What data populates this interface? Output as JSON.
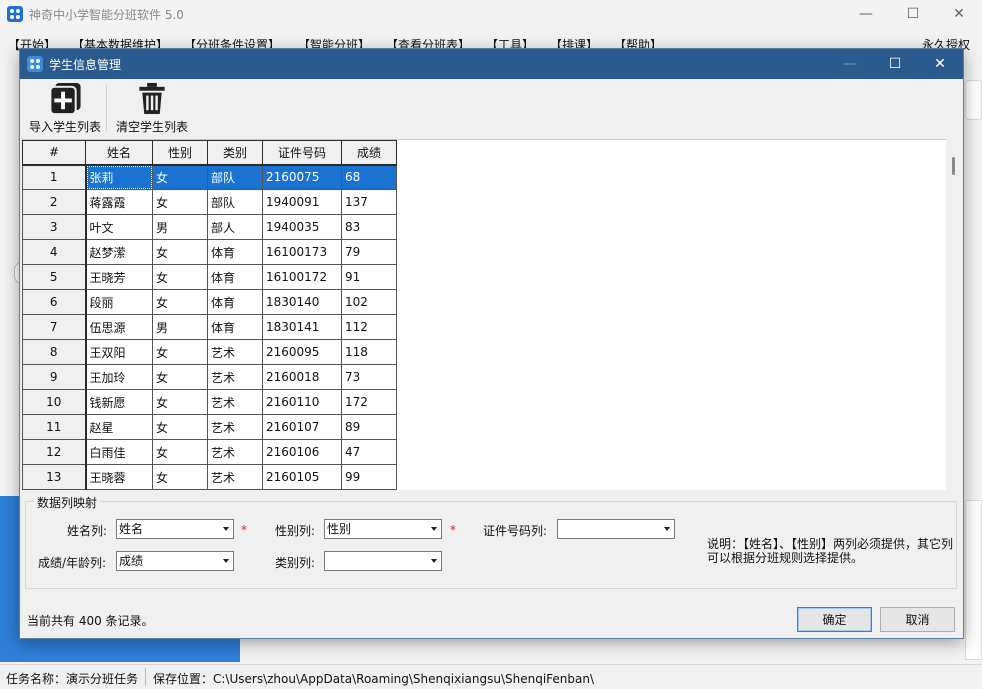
{
  "app": {
    "title": "神奇中小学智能分班软件 5.0",
    "license": "永久授权"
  },
  "menu": [
    "【开始】",
    "【基本数据维护】",
    "【分班条件设置】",
    "【智能分班】",
    "【查看分班表】",
    "【工具】",
    "【排课】",
    "【帮助】"
  ],
  "dialog": {
    "title": "学生信息管理",
    "toolbar": {
      "import_label": "导入学生列表",
      "clear_label": "清空学生列表"
    },
    "grid": {
      "columns": [
        "#",
        "姓名",
        "性别",
        "类别",
        "证件号码",
        "成绩"
      ],
      "selected_row": 1,
      "rows": [
        [
          "1",
          "张莉",
          "女",
          "部队",
          "2160075",
          "68"
        ],
        [
          "2",
          "蒋露霞",
          "女",
          "部队",
          "1940091",
          "137"
        ],
        [
          "3",
          "叶文",
          "男",
          "部人",
          "1940035",
          "83"
        ],
        [
          "4",
          "赵梦潆",
          "女",
          "体育",
          "16100173",
          "79"
        ],
        [
          "5",
          "王晓芳",
          "女",
          "体育",
          "16100172",
          "91"
        ],
        [
          "6",
          "段丽",
          "女",
          "体育",
          "1830140",
          "102"
        ],
        [
          "7",
          "伍思源",
          "男",
          "体育",
          "1830141",
          "112"
        ],
        [
          "8",
          "王双阳",
          "女",
          "艺术",
          "2160095",
          "118"
        ],
        [
          "9",
          "王加玲",
          "女",
          "艺术",
          "2160018",
          "73"
        ],
        [
          "10",
          "钱新愿",
          "女",
          "艺术",
          "2160110",
          "172"
        ],
        [
          "11",
          "赵星",
          "女",
          "艺术",
          "2160107",
          "89"
        ],
        [
          "12",
          "白雨佳",
          "女",
          "艺术",
          "2160106",
          "47"
        ],
        [
          "13",
          "王晓蓉",
          "女",
          "艺术",
          "2160105",
          "99"
        ]
      ]
    },
    "mapping": {
      "legend": "数据列映射",
      "name_label": "姓名列:",
      "name_value": "姓名",
      "gender_label": "性别列:",
      "gender_value": "性别",
      "id_label": "证件号码列:",
      "id_value": "",
      "score_label": "成绩/年龄列:",
      "score_value": "成绩",
      "category_label": "类别列:",
      "category_value": "",
      "required_mark": "*",
      "note": "说明：【姓名】、【性别】两列必须提供，其它列可以根据分班规则选择提供。"
    },
    "record_count": "当前共有 400 条记录。",
    "ok_label": "确定",
    "cancel_label": "取消"
  },
  "status": {
    "task": "任务名称：演示分班任务",
    "path": "保存位置：C:\\Users\\zhou\\AppData\\Roaming\\Shenqixiangsu\\ShenqiFenban\\"
  },
  "colors": {
    "dialog_titlebar": "#2b5b8c",
    "selection": "#1a73d1",
    "required": "#e02020"
  }
}
